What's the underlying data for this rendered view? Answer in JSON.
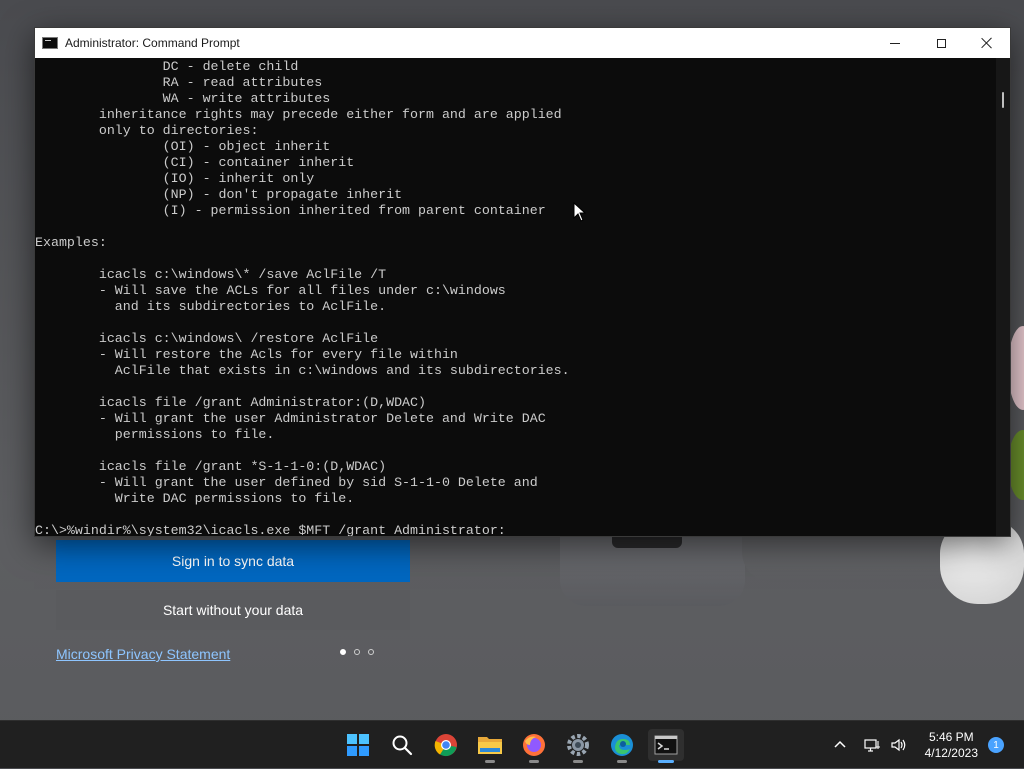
{
  "window": {
    "title": "Administrator: Command Prompt"
  },
  "console_lines": [
    "                DC - delete child",
    "                RA - read attributes",
    "                WA - write attributes",
    "        inheritance rights may precede either form and are applied",
    "        only to directories:",
    "                (OI) - object inherit",
    "                (CI) - container inherit",
    "                (IO) - inherit only",
    "                (NP) - don't propagate inherit",
    "                (I) - permission inherited from parent container",
    "",
    "Examples:",
    "",
    "        icacls c:\\windows\\* /save AclFile /T",
    "        - Will save the ACLs for all files under c:\\windows",
    "          and its subdirectories to AclFile.",
    "",
    "        icacls c:\\windows\\ /restore AclFile",
    "        - Will restore the Acls for every file within",
    "          AclFile that exists in c:\\windows and its subdirectories.",
    "",
    "        icacls file /grant Administrator:(D,WDAC)",
    "        - Will grant the user Administrator Delete and Write DAC",
    "          permissions to file.",
    "",
    "        icacls file /grant *S-1-1-0:(D,WDAC)",
    "        - Will grant the user defined by sid S-1-1-0 Delete and",
    "          Write DAC permissions to file.",
    "",
    "C:\\>%windir%\\system32\\icacls.exe $MFT /grant Administrator:"
  ],
  "setup": {
    "signin_label": "Sign in to sync data",
    "nodata_label": "Start without your data",
    "privacy_label": "Microsoft Privacy Statement",
    "pager": {
      "pages": 3,
      "active": 1
    }
  },
  "taskbar": {
    "apps": [
      "windows-start-icon",
      "search-icon",
      "chrome-icon",
      "file-explorer-icon",
      "firefox-icon",
      "settings-icon",
      "edge-icon",
      "terminal-icon"
    ],
    "time": "5:46 PM",
    "date": "4/12/2023",
    "notification_count": "1"
  },
  "colors": {
    "console_bg": "#0c0c0c",
    "console_fg": "#cccccc",
    "accent": "#0067c0",
    "taskbar_bg": "#202020"
  }
}
